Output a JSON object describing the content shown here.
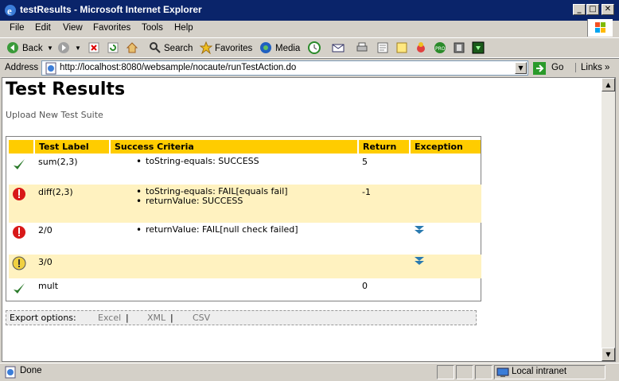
{
  "window": {
    "title": "testResults - Microsoft Internet Explorer",
    "minimize": "_",
    "maximize": "□",
    "close": "✕"
  },
  "menu": [
    "File",
    "Edit",
    "View",
    "Favorites",
    "Tools",
    "Help"
  ],
  "toolbar": {
    "back": "Back",
    "search": "Search",
    "favorites": "Favorites",
    "media": "Media"
  },
  "address": {
    "label": "Address",
    "url": "http://localhost:8080/websample/nocaute/runTestAction.do",
    "go": "Go",
    "links": "Links"
  },
  "page": {
    "title": "Test Results",
    "upload_link": "Upload New Test Suite",
    "columns": [
      "Test Label",
      "Success Criteria",
      "Return",
      "Exception"
    ],
    "rows": [
      {
        "status": "success-icon",
        "label": "sum(2,3)",
        "criteria": [
          "toString-equals: SUCCESS"
        ],
        "return": "5",
        "exception": false
      },
      {
        "status": "error-icon",
        "label": "diff(2,3)",
        "criteria": [
          "toString-equals: FAIL[equals fail]",
          "returnValue: SUCCESS"
        ],
        "return": "-1",
        "exception": false
      },
      {
        "status": "error-icon",
        "label": "2/0",
        "criteria": [
          "returnValue: FAIL[null check failed]"
        ],
        "return": "",
        "exception": true
      },
      {
        "status": "warning-icon",
        "label": "3/0",
        "criteria": [],
        "return": "",
        "exception": true
      },
      {
        "status": "success-icon",
        "label": "mult",
        "criteria": [],
        "return": "0",
        "exception": false
      }
    ],
    "export": {
      "label": "Export options:",
      "excel": "Excel",
      "xml": "XML",
      "csv": "CSV",
      "sep": "|"
    }
  },
  "status": {
    "text": "Done",
    "zone": "Local intranet"
  }
}
